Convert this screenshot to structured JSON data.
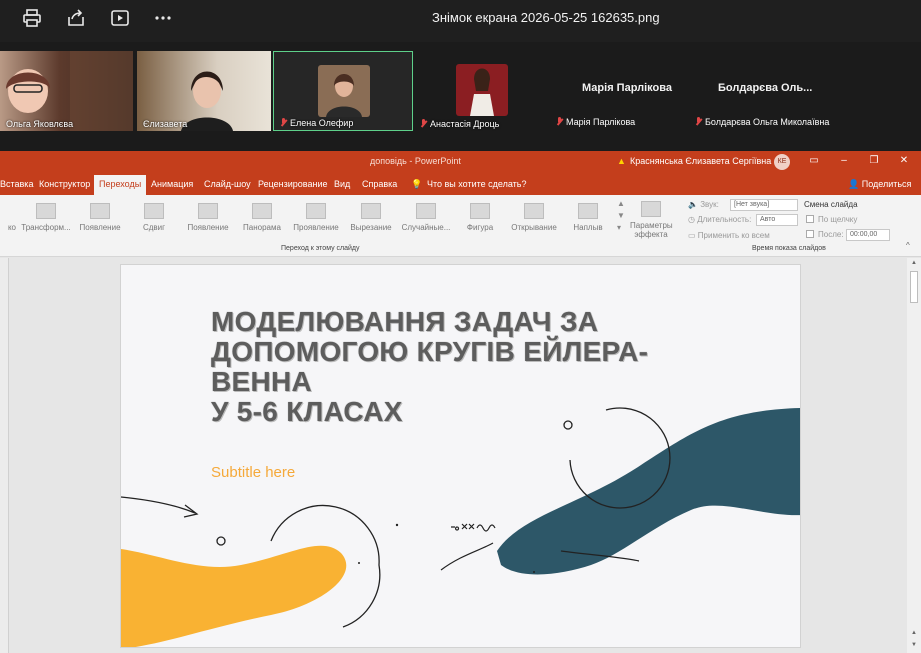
{
  "viewer": {
    "title": "Знімок екрана 2026-05-25 162635.png",
    "icons": [
      "print-icon",
      "share-icon",
      "slideshow-icon",
      "more-icon"
    ]
  },
  "participants": [
    {
      "name": "Ольга Яковлєва",
      "muted": false
    },
    {
      "name": "Єлизавета",
      "muted": false
    },
    {
      "name": "Елена Олефир",
      "muted": true
    },
    {
      "name": "Анастасія Дроць",
      "muted": true
    },
    {
      "name": "Марія Парлікова",
      "muted": true,
      "display_name": "Марія Парлікова"
    },
    {
      "name": "Болдарєва Ольга Миколаївна",
      "muted": true,
      "display_name": "Болдарєва Оль..."
    }
  ],
  "powerpoint": {
    "doc_title": "доповідь - PowerPoint",
    "user": "Краснянська Єлизавета Сергіївна",
    "user_initials": "КЕ",
    "tabs": [
      "Вставка",
      "Конструктор",
      "Переходы",
      "Анимация",
      "Слайд-шоу",
      "Рецензирование",
      "Вид",
      "Справка",
      "Что вы хотите сделать?"
    ],
    "active_tab": "Переходы",
    "share_label": "Поделиться",
    "transitions": [
      "Трансформ...",
      "Появление",
      "Сдвиг",
      "Появление",
      "Панорама",
      "Проявление",
      "Вырезание",
      "Случайные...",
      "Фигура",
      "Открывание",
      "Наплыв"
    ],
    "effects_label": "Параметры эффекта",
    "group_transition": "Переход к этому слайду",
    "group_timing": "Время показа слайдов",
    "sound_label": "Звук:",
    "sound_value": "[Нет звука]",
    "duration_label": "Длительность:",
    "duration_value": "Авто",
    "apply_all": "Применить ко всем",
    "advance_label": "Смена слайда",
    "on_click": "По щелчку",
    "after_label": "После:",
    "after_value": "00:00,00",
    "partial_label": "ко"
  },
  "slide": {
    "title_lines": [
      "МОДЕЛЮВАННЯ ЗАДАЧ ЗА",
      "ДОПОМОГОЮ КРУГІВ ЕЙЛЕРА-",
      "ВЕННА",
      "У 5-6 КЛАСАХ"
    ],
    "subtitle": "Subtitle here",
    "colors": {
      "orange": "#f9b233",
      "teal": "#2d5768",
      "title": "#5d5d5d"
    }
  }
}
